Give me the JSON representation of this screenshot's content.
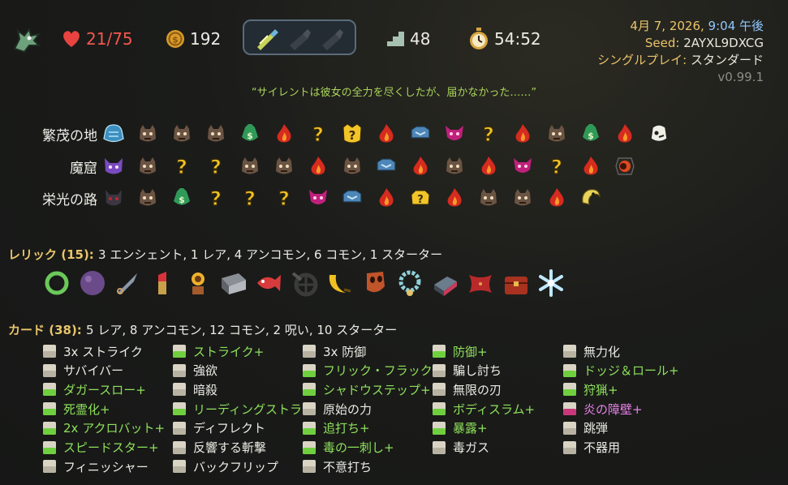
{
  "header": {
    "hp": "21/75",
    "gold": "192",
    "floor": "48",
    "time": "54:52",
    "date_prefix": "4月 7, 2026,",
    "date_time": "9:04 午後",
    "seed_label": "Seed:",
    "seed_value": "2AYXL9DXCG",
    "mode_label": "シングルプレイ:",
    "mode_value": "スタンダード",
    "version": "v0.99.1",
    "icons": {
      "character": "character-dragon-icon",
      "hp": "heart-icon",
      "gold": "coin-icon",
      "floor": "stairs-icon",
      "time": "stopwatch-icon",
      "potions": [
        "potion-icon",
        "empty-potion-slot-icon",
        "empty-potion-slot-icon"
      ]
    }
  },
  "quote": "“サイレントは彼女の全力を尽くしたが、届かなかった……”",
  "acts": [
    {
      "label": "繁茂の地",
      "nodes": [
        "boss-blue",
        "monster",
        "monster",
        "monster",
        "merchant",
        "rest",
        "unknown",
        "unknown-elite",
        "rest",
        "treasure",
        "elite",
        "unknown",
        "rest",
        "monster",
        "merchant",
        "rest",
        "boss-white"
      ]
    },
    {
      "label": "魔窟",
      "nodes": [
        "boss-purple",
        "monster",
        "unknown",
        "unknown",
        "monster",
        "monster",
        "rest",
        "monster",
        "treasure",
        "rest",
        "monster",
        "rest",
        "elite",
        "unknown",
        "rest",
        "boss-red"
      ]
    },
    {
      "label": "栄光の路",
      "nodes": [
        "boss-dark",
        "monster",
        "merchant",
        "unknown",
        "unknown",
        "unknown",
        "elite",
        "treasure",
        "rest",
        "unknown-treasure",
        "rest",
        "monster",
        "monster",
        "rest",
        "boss-yellow"
      ]
    }
  ],
  "relics": {
    "title": "レリック (15):",
    "summary": "3 エンシェント, 1 レア, 4 アンコモン, 6 コモン, 1 スターター",
    "items": [
      "ring-snake-relic-icon",
      "orb-relic-icon",
      "kunai-relic-icon",
      "lipstick-relic-icon",
      "sunflower-relic-icon",
      "tome-relic-icon",
      "fish-relic-icon",
      "wheel-relic-icon",
      "banana-relic-icon",
      "mask-relic-icon",
      "necklace-relic-icon",
      "box-relic-icon",
      "cushion-relic-icon",
      "chest-relic-icon",
      "snowflake-relic-icon"
    ]
  },
  "cards": {
    "title": "カード (38):",
    "summary": "5 レア, 8 アンコモン, 12 コモン, 2 呪い, 10 スターター",
    "columns": [
      [
        {
          "text": "3x ストライク",
          "color": "white"
        },
        {
          "text": "サバイバー",
          "color": "white"
        },
        {
          "text": "ダガースロー+",
          "color": "green"
        },
        {
          "text": "死霊化+",
          "color": "green"
        },
        {
          "text": "2x アクロバット+",
          "color": "green"
        },
        {
          "text": "スピードスター+",
          "color": "green"
        },
        {
          "text": "フィニッシャー",
          "color": "white"
        }
      ],
      [
        {
          "text": "ストライク+",
          "color": "green"
        },
        {
          "text": "強欲",
          "color": "white"
        },
        {
          "text": "暗殺",
          "color": "white"
        },
        {
          "text": "リーディングストラ…",
          "color": "green"
        },
        {
          "text": "ディフレクト",
          "color": "white"
        },
        {
          "text": "反響する斬撃",
          "color": "white"
        },
        {
          "text": "バックフリップ",
          "color": "white"
        }
      ],
      [
        {
          "text": "3x 防御",
          "color": "white"
        },
        {
          "text": "フリック・フラック+",
          "color": "green"
        },
        {
          "text": "シャドウステップ+",
          "color": "green"
        },
        {
          "text": "原始の力",
          "color": "white"
        },
        {
          "text": "追打ち+",
          "color": "green"
        },
        {
          "text": "毒の一刺し+",
          "color": "green"
        },
        {
          "text": "不意打ち",
          "color": "white"
        }
      ],
      [
        {
          "text": "防御+",
          "color": "green"
        },
        {
          "text": "騙し討ち",
          "color": "white"
        },
        {
          "text": "無限の刃",
          "color": "white"
        },
        {
          "text": "ボディスラム+",
          "color": "green"
        },
        {
          "text": "暴露+",
          "color": "green"
        },
        {
          "text": "毒ガス",
          "color": "white"
        }
      ],
      [
        {
          "text": "無力化",
          "color": "white"
        },
        {
          "text": "ドッジ＆ロール+",
          "color": "green"
        },
        {
          "text": "狩猟+",
          "color": "green"
        },
        {
          "text": "炎の障壁+",
          "color": "pink"
        },
        {
          "text": "跳弾",
          "color": "white"
        },
        {
          "text": "不器用",
          "color": "white"
        }
      ]
    ]
  },
  "colors": {
    "accent_gold": "#e9c46a",
    "upgrade_green": "#8fe05b",
    "hp_red": "#f3574e",
    "quote_green": "#a9d45a"
  }
}
